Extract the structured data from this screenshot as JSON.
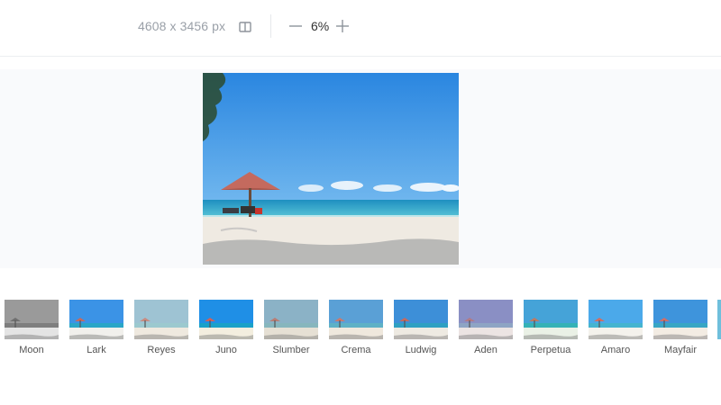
{
  "toolbar": {
    "dimensions": "4608 x 3456 px",
    "compare_icon": "compare-split-icon",
    "zoom_out_icon": "minus-icon",
    "zoom_value": "6%",
    "zoom_in_icon": "plus-icon"
  },
  "photo": {
    "subject": "beach-umbrella-photo"
  },
  "filters": [
    {
      "label": "Moon",
      "sky": "#9a9a9a",
      "sea": "#7e7e7e",
      "sand": "#e4e4e4"
    },
    {
      "label": "Lark",
      "sky": "#3b93e6",
      "sea": "#2aa6c7",
      "sand": "#f1f0ec"
    },
    {
      "label": "Reyes",
      "sky": "#9ec3d3",
      "sea": "#9cc9cf",
      "sand": "#efe9df"
    },
    {
      "label": "Juno",
      "sky": "#1f8fe6",
      "sea": "#1aa1c8",
      "sand": "#f3eedf"
    },
    {
      "label": "Slumber",
      "sky": "#8bb2c6",
      "sea": "#87b6bd",
      "sand": "#e6e0d4"
    },
    {
      "label": "Crema",
      "sky": "#5aa0d6",
      "sea": "#5eb1c6",
      "sand": "#efe8dd"
    },
    {
      "label": "Ludwig",
      "sky": "#3d8fd8",
      "sea": "#2fa0c2",
      "sand": "#eeeae2"
    },
    {
      "label": "Aden",
      "sky": "#8a8fc4",
      "sea": "#8ea4c4",
      "sand": "#ece4e3"
    },
    {
      "label": "Perpetua",
      "sky": "#45a3d8",
      "sea": "#35b2b6",
      "sand": "#eaf1e6"
    },
    {
      "label": "Amaro",
      "sky": "#4ba9ea",
      "sea": "#45b4cf",
      "sand": "#f4f2ec"
    },
    {
      "label": "Mayfair",
      "sky": "#3e94dc",
      "sea": "#38a6c4",
      "sand": "#f3ece3"
    }
  ]
}
